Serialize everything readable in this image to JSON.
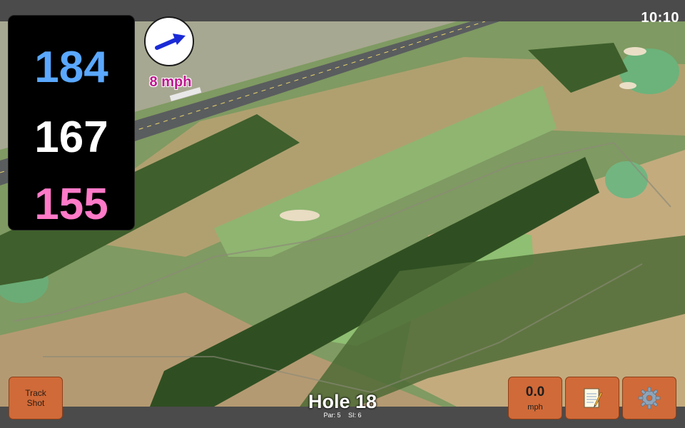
{
  "status": {
    "time": "10:10"
  },
  "distances": {
    "back": "184",
    "middle": "167",
    "front": "155"
  },
  "wind": {
    "speed_label": "8 mph",
    "direction_icon": "arrow-right-up-icon"
  },
  "hole": {
    "title": "Hole 18",
    "par_label": "Par: 5",
    "si_label": "SI: 6"
  },
  "buttons": {
    "track_shot_line1": "Track",
    "track_shot_line2": "Shot",
    "speed_value": "0.0",
    "speed_unit": "mph",
    "notes_icon": "notepad-icon",
    "settings_icon": "gear-icon"
  },
  "colors": {
    "back_distance": "#5aa8ff",
    "middle_distance": "#ffffff",
    "front_distance": "#ff7ac8",
    "button": "#d06a38",
    "wind_text": "#c0158f"
  }
}
